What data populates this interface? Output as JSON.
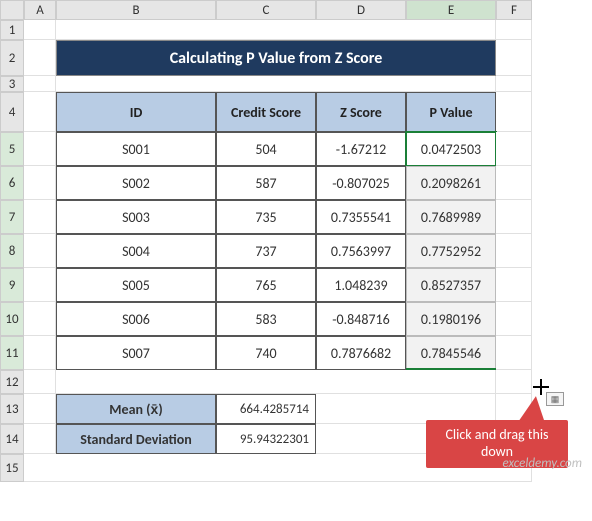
{
  "columns": [
    "",
    "A",
    "B",
    "C",
    "D",
    "E",
    "F"
  ],
  "title": "Calculating P Value from Z Score",
  "headers": {
    "id": "ID",
    "credit": "Credit Score",
    "z": "Z Score",
    "p": "P Value"
  },
  "rows": [
    {
      "id": "S001",
      "credit": "504",
      "z": "-1.67212",
      "p": "0.0472503"
    },
    {
      "id": "S002",
      "credit": "587",
      "z": "-0.807025",
      "p": "0.2098261"
    },
    {
      "id": "S003",
      "credit": "735",
      "z": "0.7355541",
      "p": "0.7689989"
    },
    {
      "id": "S004",
      "credit": "737",
      "z": "0.7563997",
      "p": "0.7752952"
    },
    {
      "id": "S005",
      "credit": "765",
      "z": "1.048239",
      "p": "0.8527357"
    },
    {
      "id": "S006",
      "credit": "583",
      "z": "-0.848716",
      "p": "0.1980196"
    },
    {
      "id": "S007",
      "credit": "740",
      "z": "0.7876682",
      "p": "0.7845546"
    }
  ],
  "stats": {
    "mean_label": "Mean (x̄)",
    "mean_value": "664.4285714",
    "sd_label": "Standard Deviation",
    "sd_value": "95.94322301"
  },
  "callout_text": "Click and drag this down",
  "watermark": "exceldemy.com",
  "chart_data": {
    "type": "table",
    "title": "Calculating P Value from Z Score",
    "columns": [
      "ID",
      "Credit Score",
      "Z Score",
      "P Value"
    ],
    "rows": [
      [
        "S001",
        504,
        -1.67212,
        0.0472503
      ],
      [
        "S002",
        587,
        -0.807025,
        0.2098261
      ],
      [
        "S003",
        735,
        0.7355541,
        0.7689989
      ],
      [
        "S004",
        737,
        0.7563997,
        0.7752952
      ],
      [
        "S005",
        765,
        1.048239,
        0.8527357
      ],
      [
        "S006",
        583,
        -0.848716,
        0.1980196
      ],
      [
        "S007",
        740,
        0.7876682,
        0.7845546
      ]
    ],
    "summary": {
      "mean": 664.4285714,
      "standard_deviation": 95.94322301
    }
  }
}
